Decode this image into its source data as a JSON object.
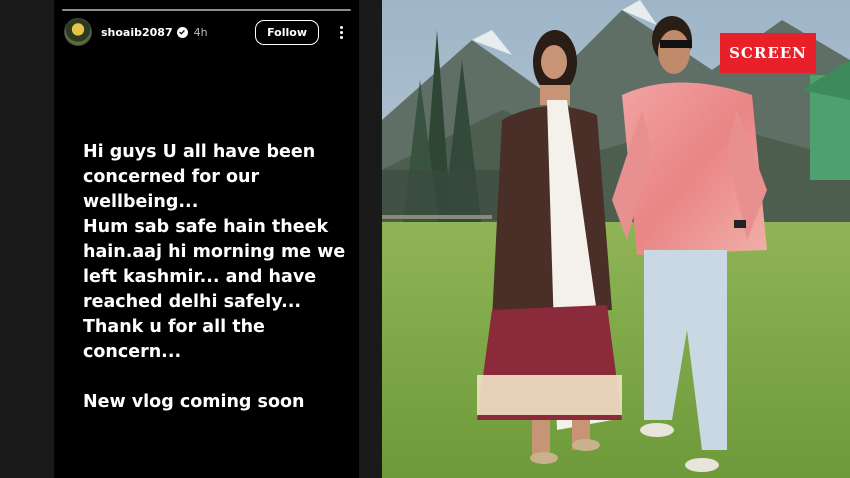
{
  "story": {
    "username": "shoaib2087",
    "time": "4h",
    "follow_label": "Follow",
    "text": "Hi guys U all have been concerned for our wellbeing...\nHum sab safe hain theek hain.aaj hi morning me we left kashmir... and have reached delhi safely...\nThank u for all the concern...\n\nNew vlog coming soon"
  },
  "photo": {
    "logo_text": "SCREEN"
  },
  "icons": {
    "verified": "verified-badge-icon",
    "more": "more-vertical-icon"
  },
  "colors": {
    "story_background": "#000000",
    "logo_red": "#e8202a",
    "grass": "#7fa64a"
  }
}
